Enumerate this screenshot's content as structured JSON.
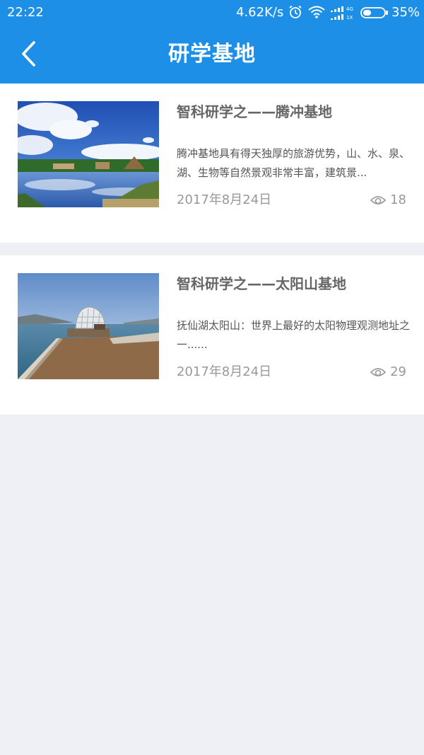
{
  "status_bar": {
    "time": "22:22",
    "network_speed": "4.62K/s",
    "signal_label_top": "4G",
    "signal_label_bottom": "1X",
    "battery": "35%"
  },
  "header": {
    "title": "研学基地",
    "background": "#1e8fe6"
  },
  "articles": [
    {
      "title": "智科研学之——腾冲基地",
      "description": "腾冲基地具有得天独厚的旅游优势，山、水、泉、湖、生物等自然景观非常丰富，建筑景...",
      "date": "2017年8月24日",
      "views": "18"
    },
    {
      "title": "智科研学之——太阳山基地",
      "description": "抚仙湖太阳山：世界上最好的太阳物理观测地址之一......",
      "date": "2017年8月24日",
      "views": "29"
    }
  ]
}
